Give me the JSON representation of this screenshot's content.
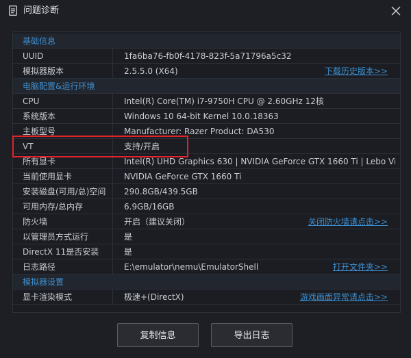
{
  "window": {
    "title": "问题诊断"
  },
  "sections": [
    {
      "label": "基础信息"
    },
    {
      "label": "电脑配置&运行环境"
    },
    {
      "label": "模拟器设置"
    }
  ],
  "rows": [
    {
      "key": "UUID",
      "value": "1fa6ba76-fb0f-4178-823f-5a71796a5c32",
      "link": ""
    },
    {
      "key": "模拟器版本",
      "value": "2.5.5.0 (X64)",
      "link": "下载历史版本>>"
    },
    {
      "key": "CPU",
      "value": "Intel(R) Core(TM) i7-9750H CPU @ 2.60GHz 12核",
      "link": ""
    },
    {
      "key": "系统版本",
      "value": "Windows 10 64-bit Kernel 10.0.18363",
      "link": ""
    },
    {
      "key": "主板型号",
      "value": "Manufacturer: Razer  Product: DA530",
      "link": ""
    },
    {
      "key": "VT",
      "value": "支持/开启",
      "link": ""
    },
    {
      "key": "所有显卡",
      "value": "Intel(R) UHD Graphics 630 | NVIDIA GeForce GTX 1660 Ti | Lebo Vi",
      "link": ""
    },
    {
      "key": "当前使用显卡",
      "value": "NVIDIA GeForce GTX 1660 Ti",
      "link": ""
    },
    {
      "key": "安装磁盘(可用/总)空间",
      "value": "290.8GB/439.5GB",
      "link": ""
    },
    {
      "key": "可用内存/总内存",
      "value": "6.9GB/16GB",
      "link": ""
    },
    {
      "key": "防火墙",
      "value": "开启（建议关闭）",
      "link": "关闭防火墙请点击>>"
    },
    {
      "key": "以管理员方式运行",
      "value": "是",
      "link": ""
    },
    {
      "key": "DirectX 11是否安装",
      "value": "是",
      "link": ""
    },
    {
      "key": "日志路径",
      "value": "E:\\emulator\\nemu\\EmulatorShell",
      "link": "打开文件夹>>"
    },
    {
      "key": "显卡渲染模式",
      "value": "极速+(DirectX)",
      "link": "游戏画面异常请点击>>"
    }
  ],
  "buttons": {
    "copy": "复制信息",
    "export": "导出日志"
  },
  "colors": {
    "background": "#1e1f25",
    "section_text": "#3f8fcf",
    "link": "#3d8fd1",
    "highlight": "#e0242a"
  }
}
